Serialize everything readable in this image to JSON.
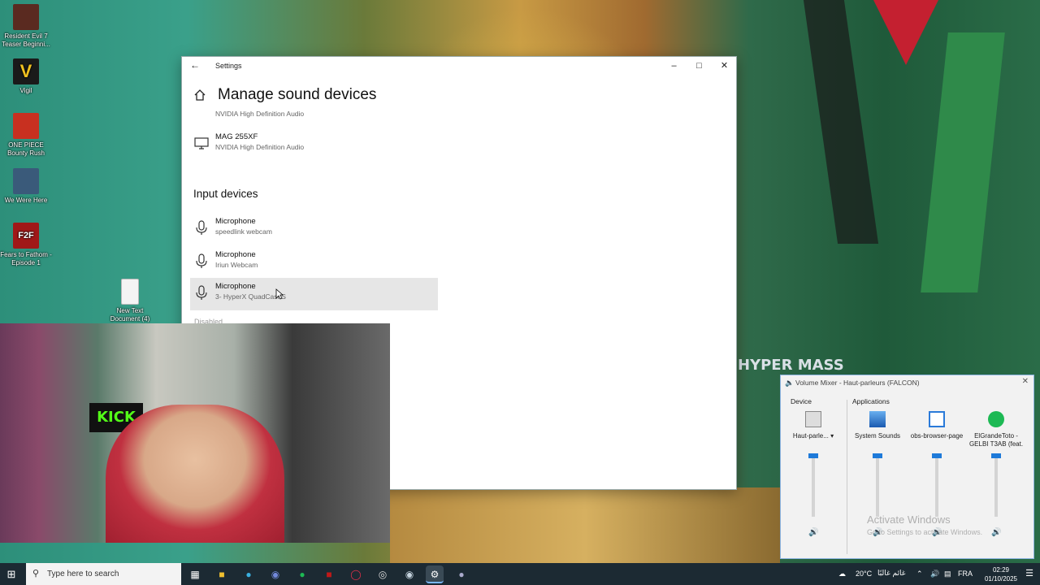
{
  "desktop": {
    "icons": [
      {
        "label": "Resident Evil 7 Teaser Beginni...",
        "icon": "re7-game-icon",
        "color": "#5a2a20"
      },
      {
        "label": "Vigil",
        "icon": "vigil-game-icon",
        "color": "#1a1a1a"
      },
      {
        "label": "ONE PIECE Bounty Rush",
        "icon": "onepiece-game-icon",
        "color": "#c83020"
      },
      {
        "label": "We Were Here",
        "icon": "wewerehere-game-icon",
        "color": "#3a5a7a"
      },
      {
        "label": "Fears to Fathom - Episode 1",
        "icon": "f2f-game-icon",
        "color": "#a01818"
      },
      {
        "label": "New Text Document (4)",
        "icon": "text-document-icon",
        "color": "#f0f0f0"
      }
    ]
  },
  "settings": {
    "window_title": "Settings",
    "page_title": "Manage sound devices",
    "output_devices": [
      {
        "name": "",
        "sub": "NVIDIA High Definition Audio",
        "icon": "monitor-icon"
      },
      {
        "name": "MAG 255XF",
        "sub": "NVIDIA High Definition Audio",
        "icon": "monitor-icon"
      }
    ],
    "input_header": "Input devices",
    "input_devices": [
      {
        "name": "Microphone",
        "sub": "speedlink  webcam",
        "icon": "microphone-icon",
        "selected": false
      },
      {
        "name": "Microphone",
        "sub": "Iriun Webcam",
        "icon": "microphone-icon",
        "selected": false
      },
      {
        "name": "Microphone",
        "sub": "3- HyperX QuadCast S",
        "icon": "microphone-icon",
        "selected": true
      }
    ],
    "disabled_header": "Disabled"
  },
  "webcam": {
    "overlay_text": "KICK"
  },
  "wallpaper": {
    "poster_text": "HYPER MASS"
  },
  "mixer": {
    "title": "Volume Mixer - Haut-parleurs (FALCON)",
    "device_label": "Device",
    "applications_label": "Applications",
    "device": {
      "name": "Haut-parle...",
      "icon": "speaker-device-icon",
      "level": 1.0
    },
    "apps": [
      {
        "name": "System Sounds",
        "icon": "system-sounds-icon",
        "level": 1.0
      },
      {
        "name": "obs-browser-page",
        "icon": "obs-window-icon",
        "level": 1.0
      },
      {
        "name": "ElGrandeToto - GELBI T3AB (feat. ...",
        "icon": "spotify-icon",
        "level": 1.0
      }
    ],
    "watermark_line1": "Activate Windows",
    "watermark_line2": "Go to Settings to activate Windows."
  },
  "taskbar": {
    "search_placeholder": "Type here to search",
    "apps": [
      {
        "name": "task-view-icon"
      },
      {
        "name": "file-explorer-icon"
      },
      {
        "name": "edge-icon"
      },
      {
        "name": "discord-icon"
      },
      {
        "name": "spotify-icon"
      },
      {
        "name": "app-red-icon"
      },
      {
        "name": "opera-gx-icon"
      },
      {
        "name": "obs-icon"
      },
      {
        "name": "steam-icon"
      },
      {
        "name": "settings-gear-icon"
      },
      {
        "name": "app-extra-icon"
      }
    ],
    "weather": "20°C",
    "weather_text": "غائم غالبًا",
    "language": "FRA",
    "time": "02:29",
    "date": "01/10/2025"
  }
}
